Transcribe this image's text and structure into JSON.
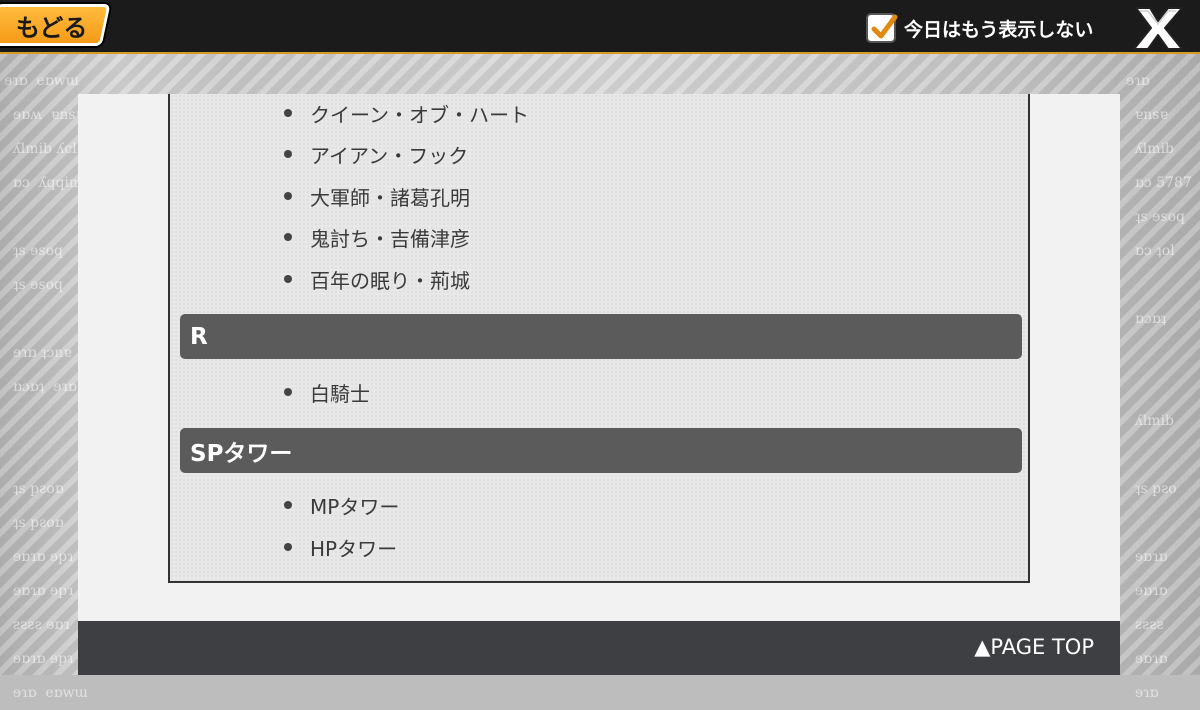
{
  "header": {
    "back_label": "もどる",
    "hide_today_label": "今日はもう表示しない",
    "hide_today_checked": true,
    "close_icon": "close-x-icon"
  },
  "content": {
    "list_top": [
      "クイーン・オブ・ハート",
      "アイアン・フック",
      "大軍師・諸葛孔明",
      "鬼討ち・吉備津彦",
      "百年の眠り・荊城"
    ],
    "section_r": {
      "title": "R",
      "items": [
        "白騎士"
      ]
    },
    "section_sp": {
      "title": "SPタワー",
      "items": [
        "MPタワー",
        "HPタワー"
      ]
    }
  },
  "footer": {
    "page_top_label": "▲PAGE TOP"
  },
  "colors": {
    "accent": "#f59b17",
    "header_bg": "#1b1b1b",
    "section_bar": "#5b5b5b",
    "footer_bg": "#3d3f42"
  }
}
